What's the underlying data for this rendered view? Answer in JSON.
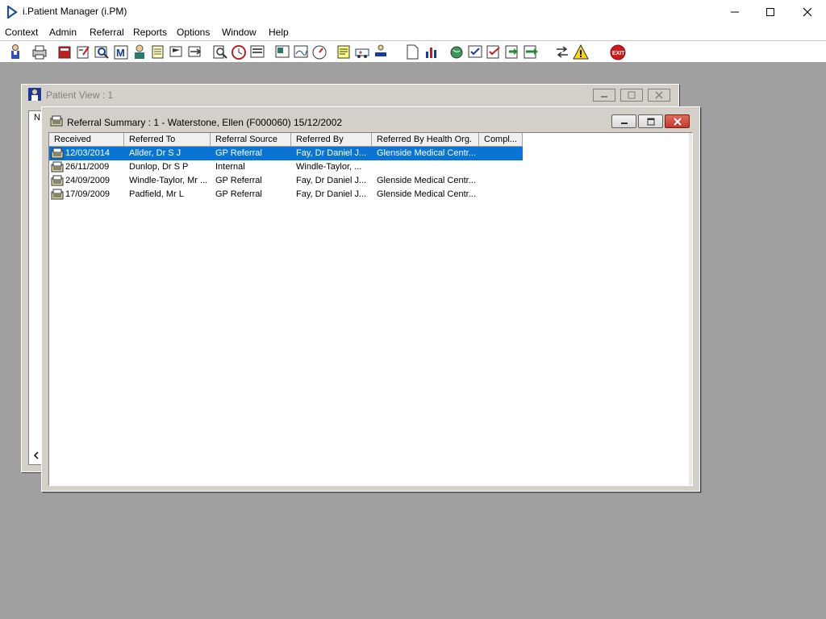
{
  "app": {
    "title": "i.Patient Manager (i.PM)"
  },
  "menubar": {
    "items": [
      "Context",
      "Admin",
      "Referral",
      "Reports",
      "Options",
      "Window",
      "Help"
    ]
  },
  "toolbar": {
    "buttons": [
      "patient-icon",
      "printer-icon",
      "book-icon",
      "edit-form-icon",
      "search-record-icon",
      "m-icon",
      "doctor-icon",
      "notepad-icon",
      "flag-icon",
      "flag-arrow-icon",
      "magnify-doc-icon",
      "clock-icon",
      "screen-icon",
      "photo-card-icon",
      "signed-card-icon",
      "gauge-icon",
      "notes-icon",
      "ambulance-icon",
      "transfer-icon",
      "blank-doc-icon",
      "chart-icon",
      "globe-icon",
      "check-list-icon",
      "check-doc-icon",
      "import-icon",
      "export-icon",
      "swap-icon",
      "warning-icon",
      "exit-icon"
    ],
    "exit_label": "EXIT"
  },
  "patient_view": {
    "title": "Patient View : 1",
    "inner_label": "N"
  },
  "referral_summary": {
    "title": "Referral Summary : 1 - Waterstone, Ellen (F000060) 15/12/2002",
    "columns": [
      "Received",
      "Referred To",
      "Referral Source",
      "Referred By",
      "Referred By Health Org.",
      "Compl..."
    ],
    "rows": [
      {
        "received": "12/03/2014",
        "referred_to": "Allder, Dr S J",
        "source": "GP Referral",
        "referred_by": "Fay, Dr Daniel J...",
        "health_org": "Glenside Medical Centr...",
        "compl": ""
      },
      {
        "received": "26/11/2009",
        "referred_to": "Dunlop, Dr S P",
        "source": "Internal",
        "referred_by": "Windle-Taylor, ...",
        "health_org": "",
        "compl": ""
      },
      {
        "received": "24/09/2009",
        "referred_to": "Windle-Taylor, Mr ...",
        "source": "GP Referral",
        "referred_by": "Fay, Dr Daniel J...",
        "health_org": "Glenside Medical Centr...",
        "compl": ""
      },
      {
        "received": "17/09/2009",
        "referred_to": "Padfield, Mr L",
        "source": "GP Referral",
        "referred_by": "Fay, Dr Daniel J...",
        "health_org": "Glenside Medical Centr...",
        "compl": ""
      }
    ]
  },
  "colors": {
    "selection": "#0a74d4",
    "mdi_background": "#a0a0a0",
    "window_face": "#d4d0c8"
  }
}
